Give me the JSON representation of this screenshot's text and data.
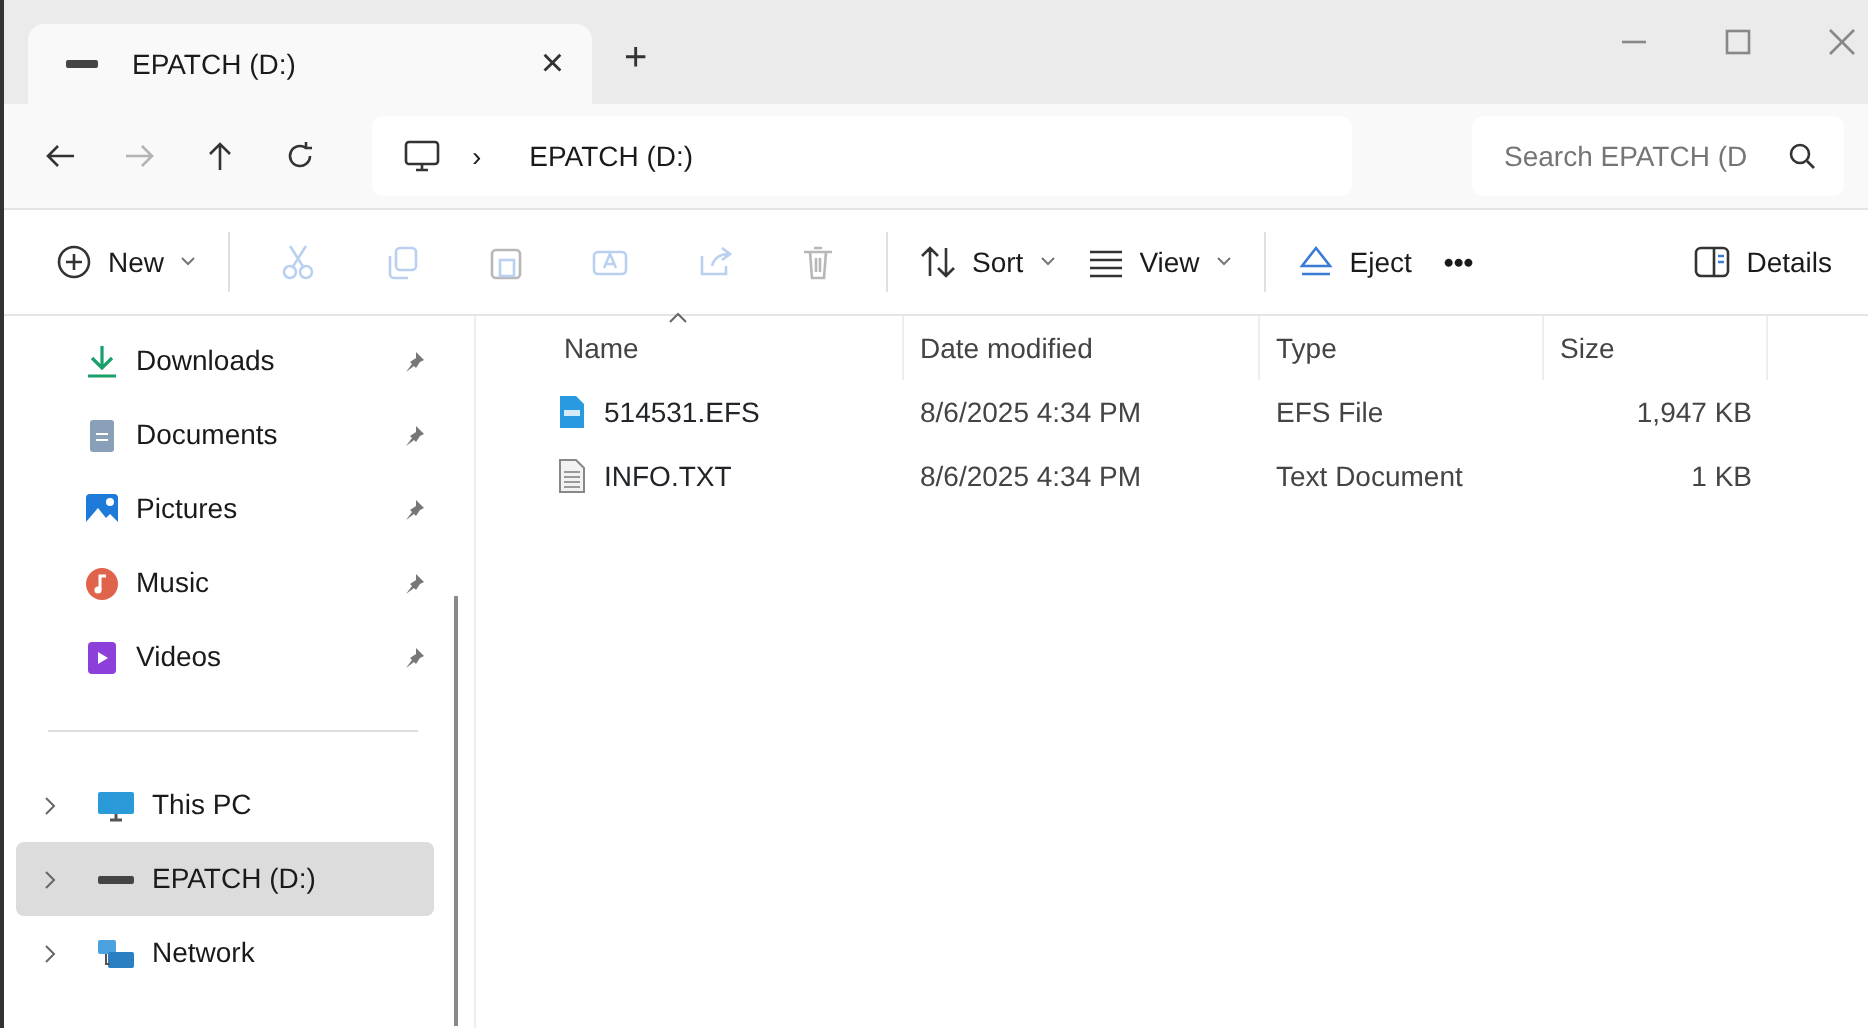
{
  "tabs": [
    {
      "title": "EPATCH (D:)",
      "selected": true,
      "close": "×"
    }
  ],
  "new_tab": "+",
  "nav": [
    {
      "kind": "back",
      "disabled": false
    },
    {
      "kind": "forward",
      "disabled": true
    },
    {
      "kind": "up",
      "disabled": false
    },
    {
      "kind": "refresh",
      "disabled": false
    }
  ],
  "address": {
    "separator": "›",
    "path": "EPATCH (D:)"
  },
  "search": {
    "placeholder": "Search EPATCH (D"
  },
  "toolbar": [
    {
      "kind": "new",
      "label": "New",
      "dropdown": true,
      "disabled": false
    },
    {
      "kind": "cut",
      "disabled": true
    },
    {
      "kind": "copy",
      "disabled": true
    },
    {
      "kind": "paste",
      "disabled": true
    },
    {
      "kind": "rename",
      "disabled": true
    },
    {
      "kind": "share",
      "disabled": true
    },
    {
      "kind": "delete",
      "disabled": true
    },
    {
      "kind": "sort",
      "label": "Sort",
      "dropdown": true,
      "disabled": false
    },
    {
      "kind": "view",
      "label": "View",
      "dropdown": true,
      "disabled": false
    },
    {
      "kind": "eject",
      "label": "Eject",
      "dropdown": false,
      "disabled": false
    },
    {
      "kind": "more",
      "label": "•••",
      "dropdown": false,
      "disabled": false
    },
    {
      "kind": "details",
      "label": "Details",
      "dropdown": false,
      "disabled": false
    }
  ],
  "sidebar": {
    "quick": [
      {
        "kind": "downloads",
        "label": "Downloads",
        "pinned": true
      },
      {
        "kind": "documents",
        "label": "Documents",
        "pinned": true
      },
      {
        "kind": "pictures",
        "label": "Pictures",
        "pinned": true
      },
      {
        "kind": "music",
        "label": "Music",
        "pinned": true
      },
      {
        "kind": "videos",
        "label": "Videos",
        "pinned": true
      }
    ],
    "locations": [
      {
        "kind": "pc",
        "label": "This PC",
        "selected": false
      },
      {
        "kind": "drive",
        "label": "EPATCH (D:)",
        "selected": true
      },
      {
        "kind": "network",
        "label": "Network",
        "selected": false
      }
    ]
  },
  "table": {
    "columns": [
      {
        "label": "Name",
        "sorted": true
      },
      {
        "label": "Date modified",
        "sorted": false
      },
      {
        "label": "Type",
        "sorted": false
      },
      {
        "label": "Size",
        "sorted": false
      }
    ],
    "rows": [
      {
        "kind": "efs",
        "name": "514531.EFS",
        "date": "8/6/2025 4:34 PM",
        "type": "EFS File",
        "size": "1,947 KB"
      },
      {
        "kind": "txt",
        "name": "INFO.TXT",
        "date": "8/6/2025 4:34 PM",
        "type": "Text Document",
        "size": "1 KB"
      }
    ]
  }
}
